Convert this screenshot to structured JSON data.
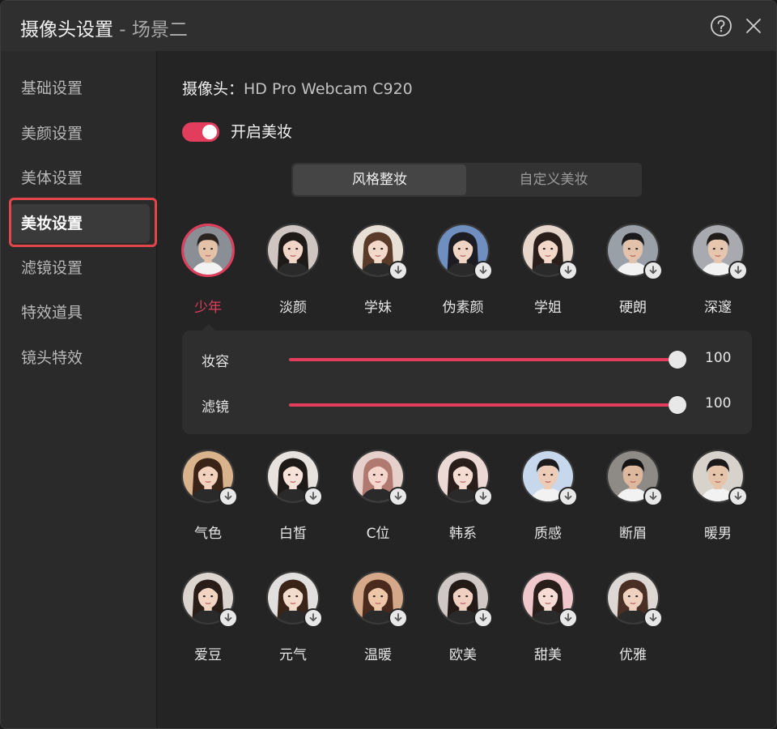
{
  "window": {
    "title_main": "摄像头设置",
    "title_scene": " - 场景二"
  },
  "sidebar": {
    "items": [
      {
        "label": "基础设置",
        "active": false
      },
      {
        "label": "美颜设置",
        "active": false
      },
      {
        "label": "美体设置",
        "active": false
      },
      {
        "label": "美妆设置",
        "active": true
      },
      {
        "label": "滤镜设置",
        "active": false
      },
      {
        "label": "特效道具",
        "active": false
      },
      {
        "label": "镜头特效",
        "active": false
      }
    ]
  },
  "camera": {
    "label": "摄像头：",
    "value": "HD Pro Webcam C920"
  },
  "makeup_toggle": {
    "label": "开启美妆",
    "on": true
  },
  "tabs": [
    {
      "label": "风格整妆",
      "active": true
    },
    {
      "label": "自定义美妆",
      "active": false
    }
  ],
  "presets_row1": [
    {
      "label": "少年",
      "selected": true,
      "download": false,
      "gender": "m",
      "bg": "#8a8f96",
      "hair": "#2a2420",
      "skin": "#e4c2a8"
    },
    {
      "label": "淡颜",
      "selected": false,
      "download": false,
      "gender": "f",
      "bg": "#cfc6c2",
      "hair": "#1e1a18",
      "skin": "#f1d6c8"
    },
    {
      "label": "学妹",
      "selected": false,
      "download": true,
      "gender": "f",
      "bg": "#e8e0d6",
      "hair": "#5a3a28",
      "skin": "#f3d9c9"
    },
    {
      "label": "伪素颜",
      "selected": false,
      "download": true,
      "gender": "f",
      "bg": "#6f8fc0",
      "hair": "#1c1c22",
      "skin": "#f0d4c4"
    },
    {
      "label": "学姐",
      "selected": false,
      "download": true,
      "gender": "f",
      "bg": "#e6d6cc",
      "hair": "#2a1e1a",
      "skin": "#f4d8c8"
    },
    {
      "label": "硬朗",
      "selected": false,
      "download": true,
      "gender": "m",
      "bg": "#9aa0a8",
      "hair": "#1a1a1c",
      "skin": "#e2c2aa"
    },
    {
      "label": "深邃",
      "selected": false,
      "download": true,
      "gender": "m",
      "bg": "#a8aab0",
      "hair": "#201c1a",
      "skin": "#e6c6ae"
    }
  ],
  "sliders": [
    {
      "label": "妆容",
      "value": 100,
      "max": 100,
      "display": "100"
    },
    {
      "label": "滤镜",
      "value": 100,
      "max": 100,
      "display": "100"
    }
  ],
  "presets_row2": [
    {
      "label": "气色",
      "download": true,
      "gender": "f",
      "bg": "#d9b38c",
      "hair": "#3a2418",
      "skin": "#f2d2bc"
    },
    {
      "label": "白皙",
      "download": true,
      "gender": "f",
      "bg": "#e8e2de",
      "hair": "#1e1a18",
      "skin": "#f6e2d8"
    },
    {
      "label": "C位",
      "download": true,
      "gender": "f",
      "bg": "#e6d0cc",
      "hair": "#b07a70",
      "skin": "#f4d6cc"
    },
    {
      "label": "韩系",
      "download": true,
      "gender": "f",
      "bg": "#ecd8d4",
      "hair": "#2a1e1a",
      "skin": "#f4dcd2"
    },
    {
      "label": "质感",
      "download": true,
      "gender": "m",
      "bg": "#c8d8ec",
      "hair": "#1c1a1a",
      "skin": "#ecccb6"
    },
    {
      "label": "断眉",
      "download": true,
      "gender": "m",
      "bg": "#8e8a86",
      "hair": "#141414",
      "skin": "#deb89c"
    },
    {
      "label": "暖男",
      "download": true,
      "gender": "m",
      "bg": "#d8d2cc",
      "hair": "#1a1818",
      "skin": "#e6c4aa"
    }
  ],
  "presets_row3": [
    {
      "label": "爱豆",
      "download": true,
      "gender": "f",
      "bg": "#dcd4ce",
      "hair": "#2a1c16",
      "skin": "#f2d4c2"
    },
    {
      "label": "元气",
      "download": true,
      "gender": "f",
      "bg": "#e2e0de",
      "hair": "#3a2418",
      "skin": "#f4dccc"
    },
    {
      "label": "温暖",
      "download": true,
      "gender": "f",
      "bg": "#d4a888",
      "hair": "#4a2a1c",
      "skin": "#eec6a8"
    },
    {
      "label": "欧美",
      "download": true,
      "gender": "f",
      "bg": "#cfc8c4",
      "hair": "#241a16",
      "skin": "#f0d0c0"
    },
    {
      "label": "甜美",
      "download": true,
      "gender": "f",
      "bg": "#f0c8cc",
      "hair": "#2a1e1a",
      "skin": "#f6dcd4"
    },
    {
      "label": "优雅",
      "download": true,
      "gender": "f",
      "bg": "#ddd8d4",
      "hair": "#4a3024",
      "skin": "#f0d2c0"
    }
  ],
  "colors": {
    "accent": "#e23d5c",
    "highlight_box": "#e2464a"
  },
  "icons": {
    "help": "question-circle-icon",
    "close": "close-icon",
    "download": "download-arrow-icon"
  }
}
